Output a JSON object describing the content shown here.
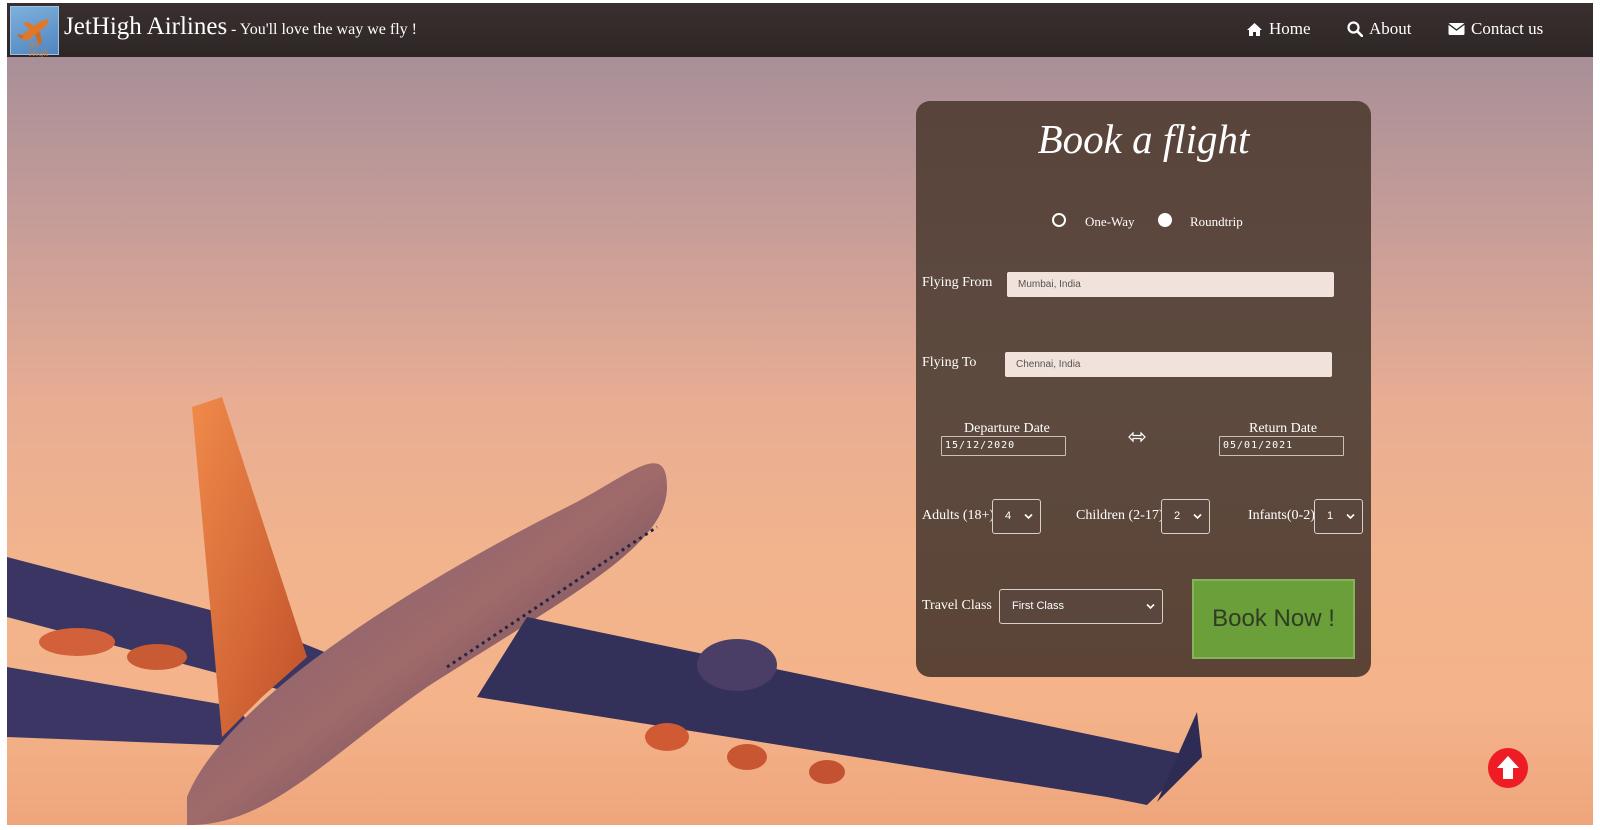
{
  "navbar": {
    "brand": "JetHigh Airlines",
    "tagline": "- You'll love the way we fly !",
    "logo_text": "jet High",
    "items": [
      {
        "label": "Home",
        "icon": "home-icon"
      },
      {
        "label": "About",
        "icon": "search-icon"
      },
      {
        "label": "Contact us",
        "icon": "envelope-icon"
      }
    ]
  },
  "booking": {
    "title": "Book a flight",
    "trip_types": [
      {
        "label": "One-Way",
        "selected": false
      },
      {
        "label": "Roundtrip",
        "selected": true
      }
    ],
    "from": {
      "label": "Flying From",
      "value": "Mumbai, India"
    },
    "to": {
      "label": "Flying To",
      "value": "Chennai, India"
    },
    "departure": {
      "label": "Departure Date",
      "value": "15/12/2020"
    },
    "return": {
      "label": "Return Date",
      "value": "05/01/2021"
    },
    "adults": {
      "label": "Adults (18+)",
      "value": "4"
    },
    "children": {
      "label": "Children (2-17)",
      "value": "2"
    },
    "infants": {
      "label": "Infants(0-2)",
      "value": "1"
    },
    "travel_class": {
      "label": "Travel Class",
      "value": "First Class"
    },
    "book_button": "Book Now !"
  },
  "colors": {
    "navbar": "#2e2626",
    "card": "#5b463b",
    "book_button": "#6a9f3a",
    "scroll_top": "#ee1c25"
  }
}
